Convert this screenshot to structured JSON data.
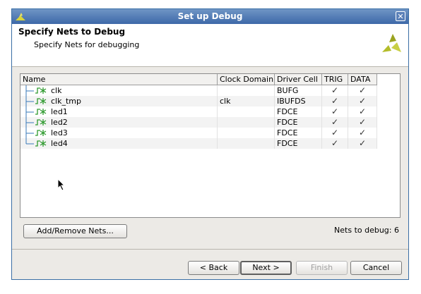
{
  "window": {
    "title": "Set up Debug",
    "close_glyph": "✕"
  },
  "header": {
    "title": "Specify Nets to Debug",
    "subtitle": "Specify Nets for debugging"
  },
  "table": {
    "columns": [
      "Name",
      "Clock Domain",
      "Driver Cell",
      "TRIG",
      "DATA"
    ],
    "rows": [
      {
        "name": "clk",
        "clock_domain": "",
        "driver_cell": "BUFG",
        "trig": "✓",
        "data": "✓"
      },
      {
        "name": "clk_tmp",
        "clock_domain": "clk",
        "driver_cell": "IBUFDS",
        "trig": "✓",
        "data": "✓"
      },
      {
        "name": "led1",
        "clock_domain": "",
        "driver_cell": "FDCE",
        "trig": "✓",
        "data": "✓"
      },
      {
        "name": "led2",
        "clock_domain": "",
        "driver_cell": "FDCE",
        "trig": "✓",
        "data": "✓"
      },
      {
        "name": "led3",
        "clock_domain": "",
        "driver_cell": "FDCE",
        "trig": "✓",
        "data": "✓"
      },
      {
        "name": "led4",
        "clock_domain": "",
        "driver_cell": "FDCE",
        "trig": "✓",
        "data": "✓"
      }
    ]
  },
  "buttons": {
    "add_remove": "Add/Remove Nets...",
    "back": "< Back",
    "next": "Next >",
    "finish": "Finish",
    "cancel": "Cancel"
  },
  "status": {
    "nets_to_debug": "Nets to debug: 6"
  },
  "colors": {
    "title_bar": "#3d68a8",
    "net_icon": "#2e9a2e",
    "logo": "#b4bd2a"
  }
}
